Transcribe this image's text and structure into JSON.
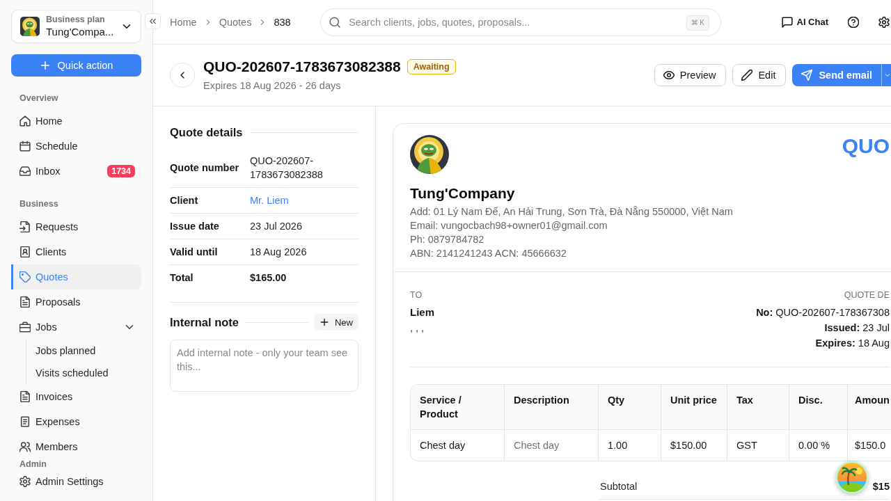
{
  "sidebar": {
    "org": {
      "plan": "Business plan",
      "name": "Tung'Compa..."
    },
    "quick_action": "Quick action",
    "sections": [
      {
        "title": "Overview",
        "items": [
          {
            "label": "Home",
            "selected": false
          },
          {
            "label": "Schedule",
            "selected": false
          },
          {
            "label": "Inbox",
            "selected": false,
            "badge": "1734"
          }
        ]
      },
      {
        "title": "Business",
        "items": [
          {
            "label": "Requests",
            "selected": false
          },
          {
            "label": "Clients",
            "selected": false
          },
          {
            "label": "Quotes",
            "selected": true
          },
          {
            "label": "Proposals",
            "selected": false
          },
          {
            "label": "Jobs",
            "selected": false,
            "expanded": true,
            "children": [
              {
                "label": "Jobs planned",
                "selected": false
              },
              {
                "label": "Visits scheduled",
                "selected": false
              }
            ]
          },
          {
            "label": "Invoices",
            "selected": false
          },
          {
            "label": "Expenses",
            "selected": false
          },
          {
            "label": "Members",
            "selected": false
          }
        ]
      }
    ],
    "admin": {
      "title": "Admin",
      "items": [
        {
          "label": "Admin Settings",
          "selected": false
        }
      ]
    }
  },
  "topbar": {
    "breadcrumbs": [
      "Home",
      "Quotes",
      "838"
    ],
    "search": {
      "placeholder": "Search clients, jobs, quotes, proposals...",
      "shortcut": "⌘ K"
    },
    "ai_chat": "AI Chat"
  },
  "header": {
    "title": "QUO-202607-1783673082388",
    "status": "Awaiting",
    "subtitle": "Expires 18 Aug 2026 - 26 days",
    "buttons": [
      {
        "label": "Preview",
        "kind": "outline"
      },
      {
        "label": "Edit",
        "kind": "outline"
      },
      {
        "label": "Send email",
        "kind": "primary"
      }
    ]
  },
  "details": {
    "title": "Quote details",
    "rows": [
      {
        "label": "Quote number",
        "value": "QUO-202607-1783673082388",
        "kind": "plain"
      },
      {
        "label": "Client",
        "value": "Mr. Liem",
        "kind": "link"
      },
      {
        "label": "Issue date",
        "value": "23 Jul 2026",
        "kind": "plain"
      },
      {
        "label": "Valid until",
        "value": "18 Aug 2026",
        "kind": "plain"
      },
      {
        "label": "Total",
        "value": "$165.00",
        "kind": "bold"
      }
    ]
  },
  "note": {
    "title": "Internal note",
    "button": "New",
    "placeholder": "Add internal note - only your team see this..."
  },
  "document": {
    "company": {
      "name": "Tung'Company",
      "lines": [
        "Add: 01 Lý Nam Đế, An Hải Trung, Sơn Trà, Đà Nẵng 550000, Việt Nam",
        "Email: vungocbach98+owner01@gmail.com",
        "Ph: 0879784782",
        "ABN: 2141241243 ACN: 45666632"
      ]
    },
    "title": "QUO",
    "to": {
      "label": "TO",
      "name": "Liem",
      "address": ", , ,"
    },
    "quote_details": {
      "label": "QUOTE DE",
      "lines": [
        "**No:** QUO-202607-178367308",
        "**Issued:** 23 Jul",
        "**Expires:** 18 Aug"
      ]
    },
    "table": {
      "columns": [
        "Service / Product",
        "Description",
        "Qty",
        "Unit price",
        "Tax",
        "Disc.",
        "Amoun"
      ],
      "rows": [
        [
          "Chest day",
          "Chest day",
          "1.00",
          "$150.00",
          "GST",
          "0.00 %",
          "$150.0"
        ]
      ]
    },
    "totals": [
      {
        "label": "Subtotal",
        "value": "$15"
      }
    ]
  }
}
